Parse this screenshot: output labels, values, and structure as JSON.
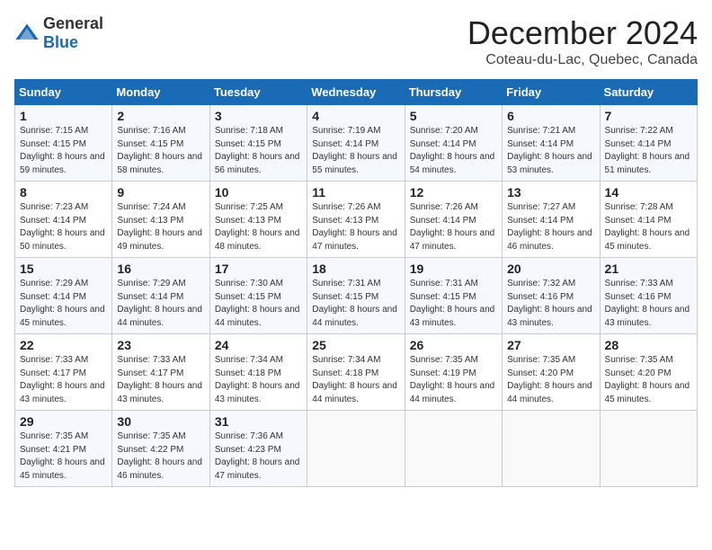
{
  "header": {
    "logo_general": "General",
    "logo_blue": "Blue",
    "month": "December 2024",
    "location": "Coteau-du-Lac, Quebec, Canada"
  },
  "days_of_week": [
    "Sunday",
    "Monday",
    "Tuesday",
    "Wednesday",
    "Thursday",
    "Friday",
    "Saturday"
  ],
  "weeks": [
    [
      {
        "day": "1",
        "sunrise": "Sunrise: 7:15 AM",
        "sunset": "Sunset: 4:15 PM",
        "daylight": "Daylight: 8 hours and 59 minutes."
      },
      {
        "day": "2",
        "sunrise": "Sunrise: 7:16 AM",
        "sunset": "Sunset: 4:15 PM",
        "daylight": "Daylight: 8 hours and 58 minutes."
      },
      {
        "day": "3",
        "sunrise": "Sunrise: 7:18 AM",
        "sunset": "Sunset: 4:15 PM",
        "daylight": "Daylight: 8 hours and 56 minutes."
      },
      {
        "day": "4",
        "sunrise": "Sunrise: 7:19 AM",
        "sunset": "Sunset: 4:14 PM",
        "daylight": "Daylight: 8 hours and 55 minutes."
      },
      {
        "day": "5",
        "sunrise": "Sunrise: 7:20 AM",
        "sunset": "Sunset: 4:14 PM",
        "daylight": "Daylight: 8 hours and 54 minutes."
      },
      {
        "day": "6",
        "sunrise": "Sunrise: 7:21 AM",
        "sunset": "Sunset: 4:14 PM",
        "daylight": "Daylight: 8 hours and 53 minutes."
      },
      {
        "day": "7",
        "sunrise": "Sunrise: 7:22 AM",
        "sunset": "Sunset: 4:14 PM",
        "daylight": "Daylight: 8 hours and 51 minutes."
      }
    ],
    [
      {
        "day": "8",
        "sunrise": "Sunrise: 7:23 AM",
        "sunset": "Sunset: 4:14 PM",
        "daylight": "Daylight: 8 hours and 50 minutes."
      },
      {
        "day": "9",
        "sunrise": "Sunrise: 7:24 AM",
        "sunset": "Sunset: 4:13 PM",
        "daylight": "Daylight: 8 hours and 49 minutes."
      },
      {
        "day": "10",
        "sunrise": "Sunrise: 7:25 AM",
        "sunset": "Sunset: 4:13 PM",
        "daylight": "Daylight: 8 hours and 48 minutes."
      },
      {
        "day": "11",
        "sunrise": "Sunrise: 7:26 AM",
        "sunset": "Sunset: 4:13 PM",
        "daylight": "Daylight: 8 hours and 47 minutes."
      },
      {
        "day": "12",
        "sunrise": "Sunrise: 7:26 AM",
        "sunset": "Sunset: 4:14 PM",
        "daylight": "Daylight: 8 hours and 47 minutes."
      },
      {
        "day": "13",
        "sunrise": "Sunrise: 7:27 AM",
        "sunset": "Sunset: 4:14 PM",
        "daylight": "Daylight: 8 hours and 46 minutes."
      },
      {
        "day": "14",
        "sunrise": "Sunrise: 7:28 AM",
        "sunset": "Sunset: 4:14 PM",
        "daylight": "Daylight: 8 hours and 45 minutes."
      }
    ],
    [
      {
        "day": "15",
        "sunrise": "Sunrise: 7:29 AM",
        "sunset": "Sunset: 4:14 PM",
        "daylight": "Daylight: 8 hours and 45 minutes."
      },
      {
        "day": "16",
        "sunrise": "Sunrise: 7:29 AM",
        "sunset": "Sunset: 4:14 PM",
        "daylight": "Daylight: 8 hours and 44 minutes."
      },
      {
        "day": "17",
        "sunrise": "Sunrise: 7:30 AM",
        "sunset": "Sunset: 4:15 PM",
        "daylight": "Daylight: 8 hours and 44 minutes."
      },
      {
        "day": "18",
        "sunrise": "Sunrise: 7:31 AM",
        "sunset": "Sunset: 4:15 PM",
        "daylight": "Daylight: 8 hours and 44 minutes."
      },
      {
        "day": "19",
        "sunrise": "Sunrise: 7:31 AM",
        "sunset": "Sunset: 4:15 PM",
        "daylight": "Daylight: 8 hours and 43 minutes."
      },
      {
        "day": "20",
        "sunrise": "Sunrise: 7:32 AM",
        "sunset": "Sunset: 4:16 PM",
        "daylight": "Daylight: 8 hours and 43 minutes."
      },
      {
        "day": "21",
        "sunrise": "Sunrise: 7:33 AM",
        "sunset": "Sunset: 4:16 PM",
        "daylight": "Daylight: 8 hours and 43 minutes."
      }
    ],
    [
      {
        "day": "22",
        "sunrise": "Sunrise: 7:33 AM",
        "sunset": "Sunset: 4:17 PM",
        "daylight": "Daylight: 8 hours and 43 minutes."
      },
      {
        "day": "23",
        "sunrise": "Sunrise: 7:33 AM",
        "sunset": "Sunset: 4:17 PM",
        "daylight": "Daylight: 8 hours and 43 minutes."
      },
      {
        "day": "24",
        "sunrise": "Sunrise: 7:34 AM",
        "sunset": "Sunset: 4:18 PM",
        "daylight": "Daylight: 8 hours and 43 minutes."
      },
      {
        "day": "25",
        "sunrise": "Sunrise: 7:34 AM",
        "sunset": "Sunset: 4:18 PM",
        "daylight": "Daylight: 8 hours and 44 minutes."
      },
      {
        "day": "26",
        "sunrise": "Sunrise: 7:35 AM",
        "sunset": "Sunset: 4:19 PM",
        "daylight": "Daylight: 8 hours and 44 minutes."
      },
      {
        "day": "27",
        "sunrise": "Sunrise: 7:35 AM",
        "sunset": "Sunset: 4:20 PM",
        "daylight": "Daylight: 8 hours and 44 minutes."
      },
      {
        "day": "28",
        "sunrise": "Sunrise: 7:35 AM",
        "sunset": "Sunset: 4:20 PM",
        "daylight": "Daylight: 8 hours and 45 minutes."
      }
    ],
    [
      {
        "day": "29",
        "sunrise": "Sunrise: 7:35 AM",
        "sunset": "Sunset: 4:21 PM",
        "daylight": "Daylight: 8 hours and 45 minutes."
      },
      {
        "day": "30",
        "sunrise": "Sunrise: 7:35 AM",
        "sunset": "Sunset: 4:22 PM",
        "daylight": "Daylight: 8 hours and 46 minutes."
      },
      {
        "day": "31",
        "sunrise": "Sunrise: 7:36 AM",
        "sunset": "Sunset: 4:23 PM",
        "daylight": "Daylight: 8 hours and 47 minutes."
      },
      null,
      null,
      null,
      null
    ]
  ]
}
